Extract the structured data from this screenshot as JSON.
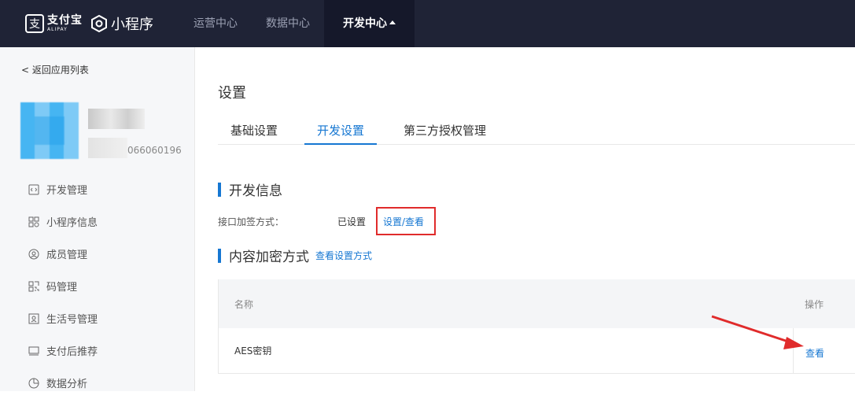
{
  "header": {
    "alipay_cn": "支付宝",
    "alipay_en": "ALIPAY",
    "mini_program": "小程序",
    "nav": [
      "运营中心",
      "数据中心",
      "开发中心"
    ]
  },
  "sidebar": {
    "back": "返回应用列表",
    "app_id": "066060196",
    "menu": [
      {
        "label": "开发管理",
        "icon": "code-icon"
      },
      {
        "label": "小程序信息",
        "icon": "grid-icon"
      },
      {
        "label": "成员管理",
        "icon": "user-circle-icon"
      },
      {
        "label": "码管理",
        "icon": "qrcode-icon"
      },
      {
        "label": "生活号管理",
        "icon": "lifestyle-icon"
      },
      {
        "label": "支付后推荐",
        "icon": "monitor-icon"
      },
      {
        "label": "数据分析",
        "icon": "pie-chart-icon"
      }
    ]
  },
  "main": {
    "title": "设置",
    "tabs": [
      "基础设置",
      "开发设置",
      "第三方授权管理"
    ],
    "section1_title": "开发信息",
    "encrypt_label": "接口加签方式：",
    "encrypt_status": "已设置",
    "encrypt_link": "设置/查看",
    "section2_title": "内容加密方式",
    "section2_link": "查看设置方式",
    "table": {
      "col_name": "名称",
      "col_op": "操作",
      "row_name": "AES密钥",
      "row_op": "查看"
    }
  },
  "colors": {
    "accent": "#1677d2",
    "topbar": "#1f2336",
    "highlight": "#e02b2b"
  }
}
